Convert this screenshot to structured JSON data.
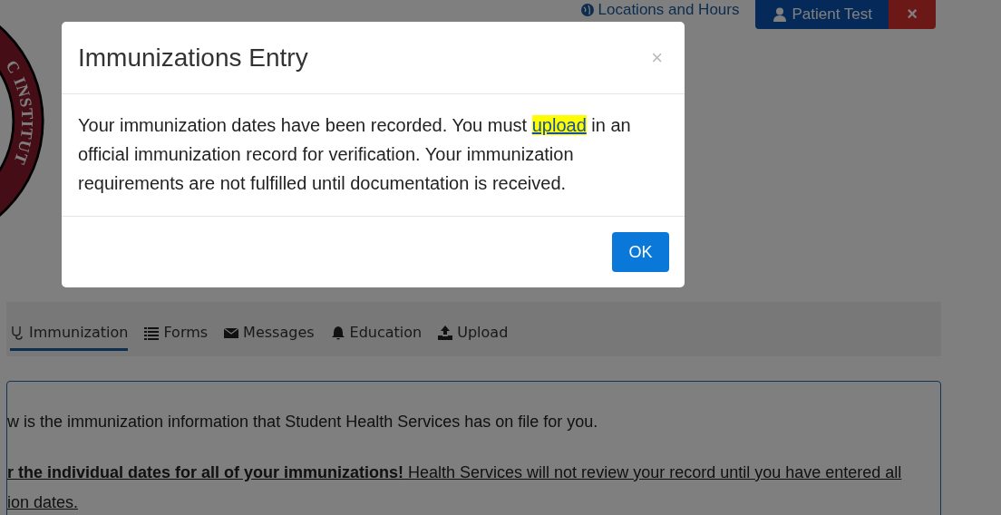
{
  "header": {
    "locations_link": "Locations and Hours",
    "user_button": "Patient Test",
    "close_button": "×"
  },
  "logo": {
    "text": "C INSTITUT"
  },
  "tabs": [
    {
      "label": "Immunization",
      "selected": true
    },
    {
      "label": "Forms",
      "selected": false
    },
    {
      "label": "Messages",
      "selected": false
    },
    {
      "label": "Education",
      "selected": false
    },
    {
      "label": "Upload",
      "selected": false
    }
  ],
  "panel": {
    "paragraphs": [
      {
        "kind": "plain",
        "lines": [
          "w is the immunization information that Student Health Services has on file for you."
        ]
      },
      {
        "kind": "notice",
        "lines": [
          "**r the individual dates for all of your immunizations!** Health Services will not review your record until you have entered all",
          "ion dates."
        ]
      }
    ]
  },
  "modal": {
    "title": "Immunizations Entry",
    "close": "×",
    "message": {
      "before": "Your immunization dates have been recorded. You must ",
      "link": "upload",
      "after": " in an official immunization record for verification. Your immunization requirements are not fulfilled until documentation is received."
    },
    "button": "OK"
  }
}
